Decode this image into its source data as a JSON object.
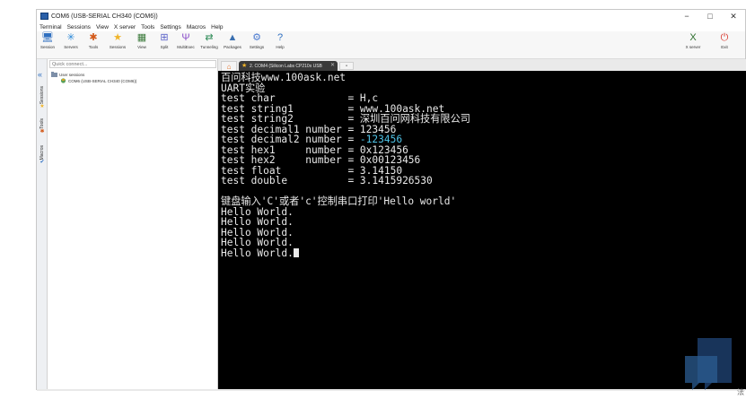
{
  "window": {
    "title": "COM6 (USB-SERIAL CH340 (COM6))",
    "controls": {
      "minimize": "−",
      "maximize": "□",
      "close": "✕"
    }
  },
  "menu": [
    "Terminal",
    "Sessions",
    "View",
    "X server",
    "Tools",
    "Settings",
    "Macros",
    "Help"
  ],
  "toolbar": {
    "items": [
      {
        "label": "Session",
        "icon": "session-icon",
        "glyph": "🖥",
        "color": "#2f6fc0"
      },
      {
        "label": "Servers",
        "icon": "servers-icon",
        "glyph": "✳",
        "color": "#2a88d8"
      },
      {
        "label": "Tools",
        "icon": "tools-icon",
        "glyph": "✱",
        "color": "#d35a1a"
      },
      {
        "label": "Sessions",
        "icon": "sessions-icon",
        "glyph": "★",
        "color": "#f0b429"
      },
      {
        "label": "View",
        "icon": "view-icon",
        "glyph": "▦",
        "color": "#3b7a3b"
      },
      {
        "label": "Split",
        "icon": "split-icon",
        "glyph": "⊞",
        "color": "#5a62c9"
      },
      {
        "label": "MultiExec",
        "icon": "multiexec-icon",
        "glyph": "Ψ",
        "color": "#8a4fc9"
      },
      {
        "label": "Tunneling",
        "icon": "tunneling-icon",
        "glyph": "⇄",
        "color": "#2e8b57"
      },
      {
        "label": "Packages",
        "icon": "packages-icon",
        "glyph": "▲",
        "color": "#3a6fb0"
      },
      {
        "label": "Settings",
        "icon": "settings-icon",
        "glyph": "⚙",
        "color": "#4c7bd0"
      },
      {
        "label": "Help",
        "icon": "help-icon",
        "glyph": "?",
        "color": "#2f6fc0"
      }
    ],
    "right_items": [
      {
        "label": "X server",
        "icon": "x-server-icon",
        "glyph": "X",
        "color": "#2d6e2d"
      },
      {
        "label": "Exit",
        "icon": "exit-icon",
        "glyph": "⏻",
        "color": "#d9352b"
      }
    ]
  },
  "sidebar": {
    "quick_connect_placeholder": "Quick connect...",
    "vertical_tabs": [
      {
        "label": "Sessions",
        "icon": "sessions-star-icon",
        "glyph": "★",
        "color": "#f0b429"
      },
      {
        "label": "Tools",
        "icon": "tools-tab-icon",
        "glyph": "✱",
        "color": "#d35a1a"
      },
      {
        "label": "Macros",
        "icon": "macros-tab-icon",
        "glyph": "✔",
        "color": "#2f6fc0"
      }
    ],
    "tree": {
      "root": "User sessions",
      "child": "COM6 (USB-SERIAL CH340 (COM6))"
    }
  },
  "tabs": {
    "active_session": "2. COM4 (Silicon Labs CP210x USB"
  },
  "terminal": {
    "lines": [
      {
        "text": "百问科技www.100ask.net"
      },
      {
        "text": "UART实验"
      },
      {
        "text": "test char            = H,c"
      },
      {
        "text": "test string1         = www.100ask.net"
      },
      {
        "text": "test string2         = 深圳百问网科技有限公司"
      },
      {
        "text": "test decimal1 number = 123456"
      },
      {
        "text": "test decimal2 number = ",
        "highlight": "-123456"
      },
      {
        "text": "test hex1     number = 0x123456"
      },
      {
        "text": "test hex2     number = 0x00123456"
      },
      {
        "text": "test float           = 3.14150"
      },
      {
        "text": "test double          = 3.1415926530"
      },
      {
        "text": ""
      },
      {
        "text": "键盘输入'C'或者'c'控制串口打印'Hello world'"
      },
      {
        "text": "Hello World."
      },
      {
        "text": "Hello World."
      },
      {
        "text": "Hello World."
      },
      {
        "text": "Hello World."
      },
      {
        "text": "Hello World.",
        "cursor": true
      }
    ]
  },
  "corner_text": "法"
}
